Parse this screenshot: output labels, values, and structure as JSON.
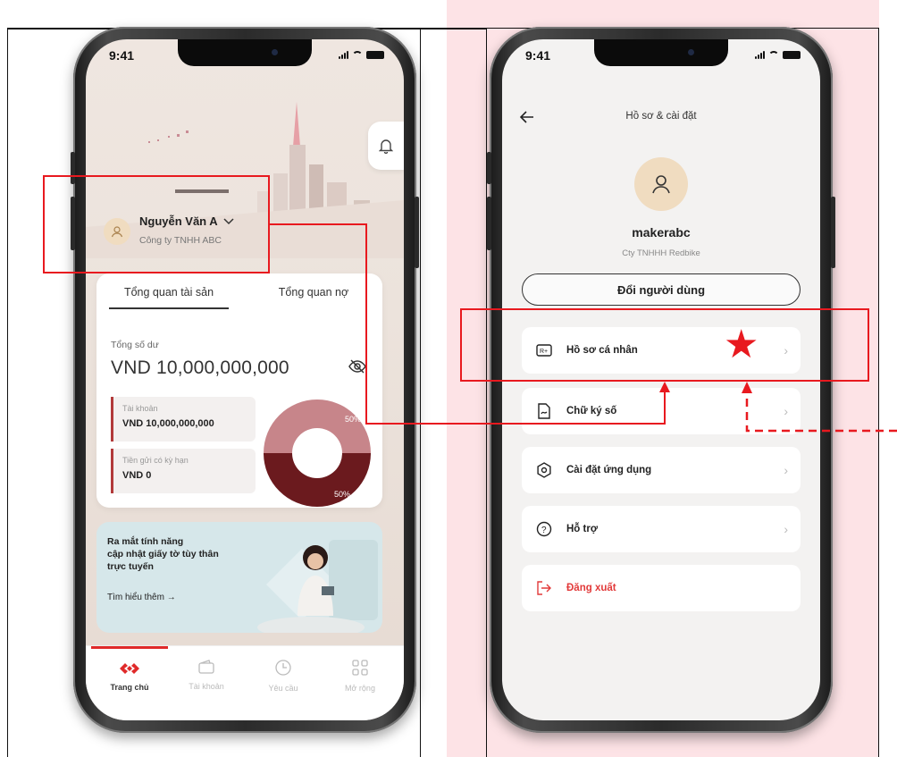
{
  "left_phone": {
    "status": {
      "time": "9:41"
    },
    "user": {
      "name": "Nguyễn Văn A",
      "company": "Công ty TNHH ABC"
    },
    "tabs": [
      {
        "label": "Tổng quan tài sản",
        "active": true
      },
      {
        "label": "Tổng quan nợ",
        "active": false
      }
    ],
    "balance": {
      "label": "Tổng số dư",
      "value": "VND 10,000,000,000"
    },
    "accounts": [
      {
        "label": "Tài khoản",
        "value": "VND 10,000,000,000"
      },
      {
        "label": "Tiền gửi có kỳ hạn",
        "value": "VND 0"
      }
    ],
    "donut": {
      "top_label": "50%",
      "bottom_label": "50%",
      "top_color": "#c7858a",
      "bottom_color": "#6b1a1e"
    },
    "promo": {
      "line1": "Ra mắt tính năng",
      "line2": "cập nhật giấy tờ tùy thân",
      "line3": "trực tuyến",
      "link": "Tìm hiểu thêm →"
    },
    "tabbar": [
      {
        "label": "Trang chủ",
        "icon": "techcombank-logo-icon",
        "active": true
      },
      {
        "label": "Tài khoản",
        "icon": "wallet-icon",
        "active": false
      },
      {
        "label": "Yêu cầu",
        "icon": "clock-icon",
        "active": false
      },
      {
        "label": "Mở rộng",
        "icon": "grid-icon",
        "active": false
      }
    ]
  },
  "right_phone": {
    "status": {
      "time": "9:41"
    },
    "header": {
      "title": "Hồ sơ & cài đặt",
      "back_icon": "arrow-left-icon"
    },
    "user": {
      "username": "makerabc",
      "company": "Cty TNHHH Redbike"
    },
    "switch_user_label": "Đổi người dùng",
    "menu": [
      {
        "label": "Hồ sơ cá nhân",
        "icon": "profile-card-icon"
      },
      {
        "label": "Chữ ký số",
        "icon": "digital-signature-icon"
      },
      {
        "label": "Cài đặt ứng dụng",
        "icon": "gear-icon"
      },
      {
        "label": "Hỗ trợ",
        "icon": "help-icon"
      },
      {
        "label": "Đăng xuất",
        "icon": "logout-icon"
      }
    ]
  },
  "annotations": {
    "highlight_color": "#e8191f",
    "marker": "★"
  }
}
